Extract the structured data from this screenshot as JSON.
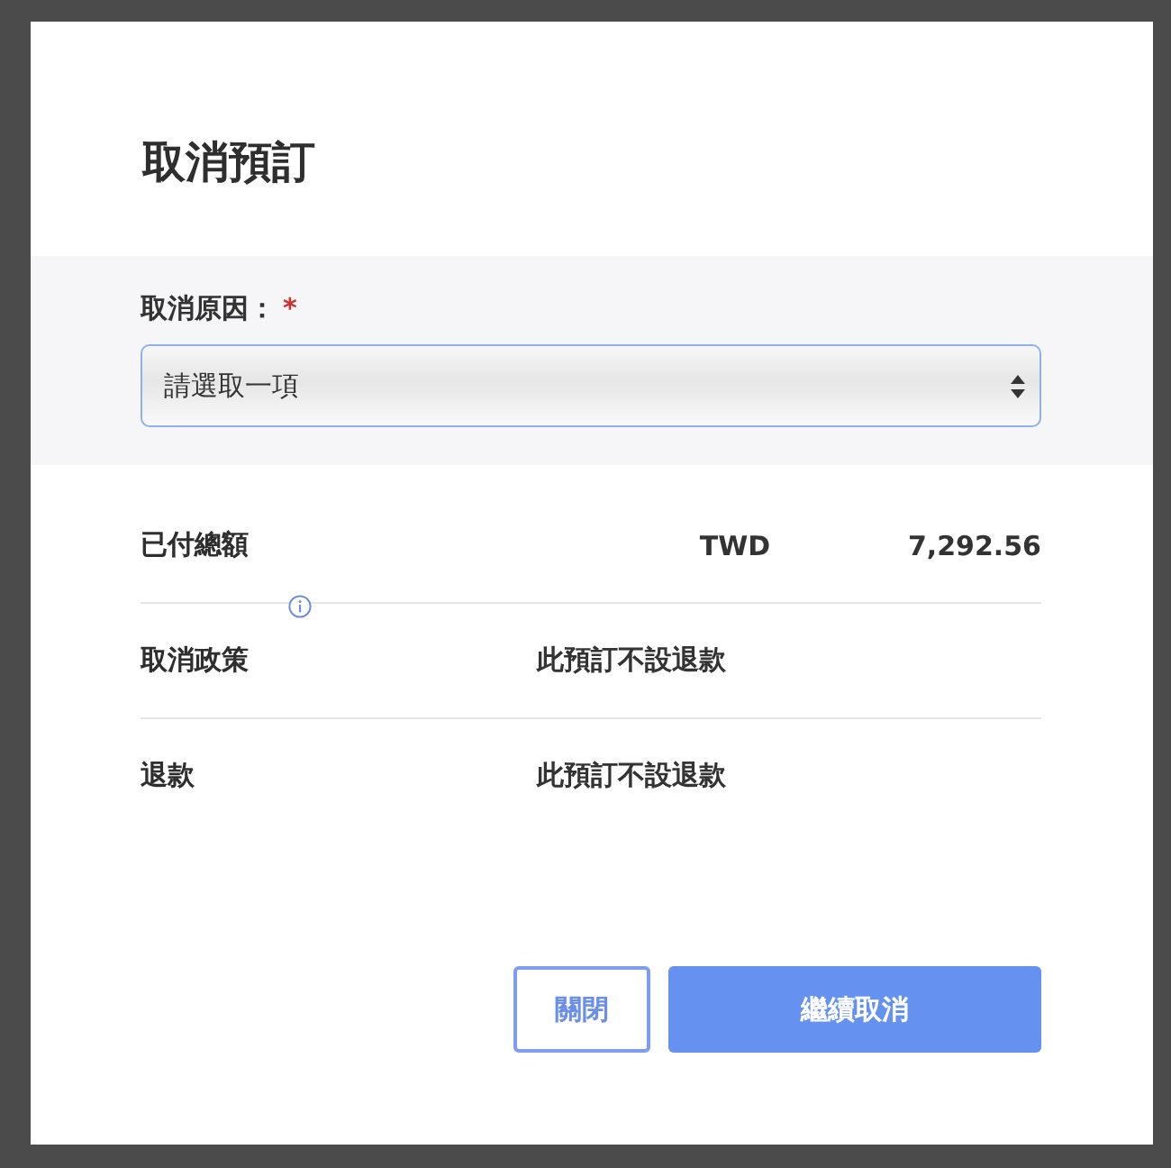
{
  "dialog": {
    "title": "取消預訂",
    "reason": {
      "label": "取消原因：",
      "required_mark": "*",
      "placeholder": "請選取一項"
    },
    "rows": [
      {
        "label": "已付總額",
        "currency": "TWD",
        "value": "7,292.56",
        "info": false
      },
      {
        "label": "取消政策",
        "value": "此預訂不設退款",
        "info": true
      },
      {
        "label": "退款",
        "value": "此預訂不設退款",
        "info": false
      }
    ],
    "buttons": [
      {
        "label": "關閉",
        "kind": "secondary"
      },
      {
        "label": "繼續取消",
        "kind": "primary"
      }
    ]
  }
}
